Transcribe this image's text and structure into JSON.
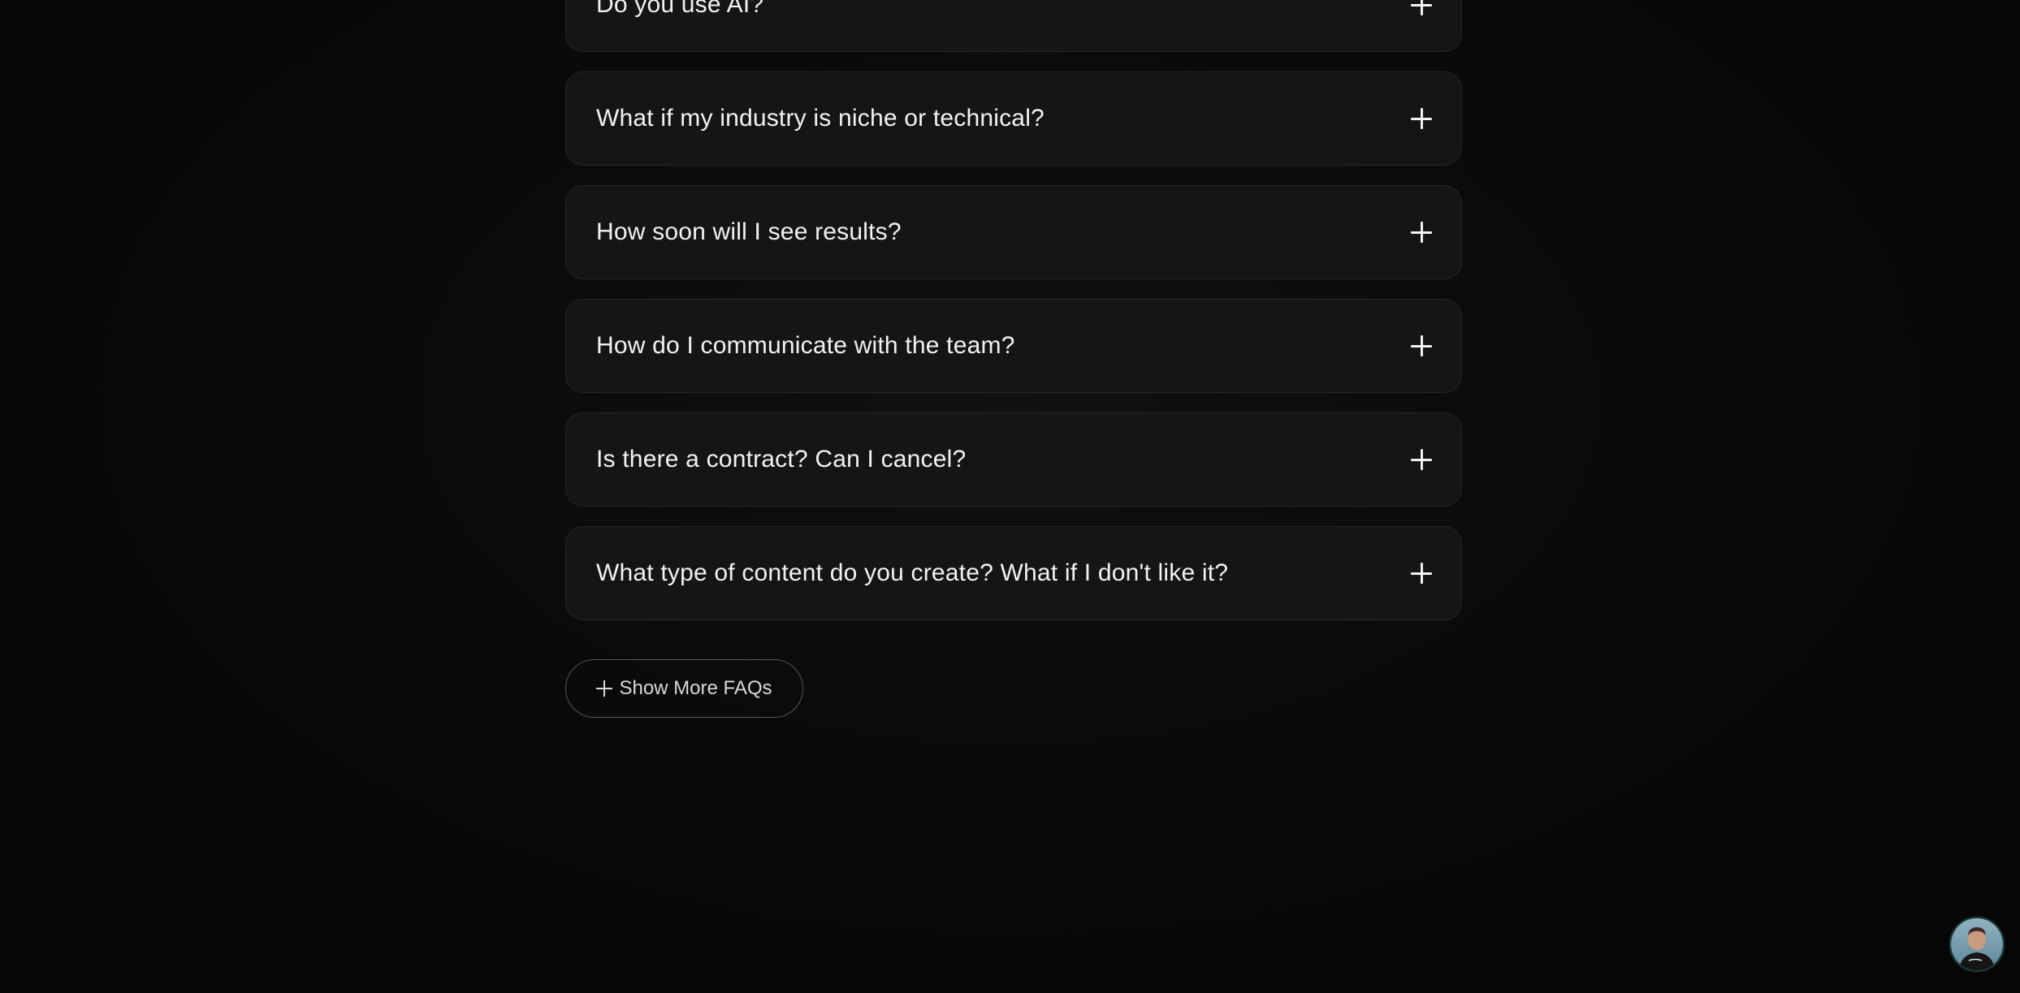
{
  "faq": {
    "items": [
      {
        "question": "Do you use AI?"
      },
      {
        "question": "What if my industry is niche or technical?"
      },
      {
        "question": "How soon will I see results?"
      },
      {
        "question": "How do I communicate with the team?"
      },
      {
        "question": "Is there a contract? Can I cancel?"
      },
      {
        "question": "What type of content do you create? What if I don't like it?"
      }
    ],
    "show_more_label": "Show More FAQs",
    "expand_icon": "plus-icon"
  },
  "chat_widget": {
    "avatar_icon": "person-avatar"
  },
  "colors": {
    "background": "#080808",
    "card": "#151515",
    "card_border": "#262626",
    "text": "#f2f2f2",
    "button_border": "#555555"
  }
}
